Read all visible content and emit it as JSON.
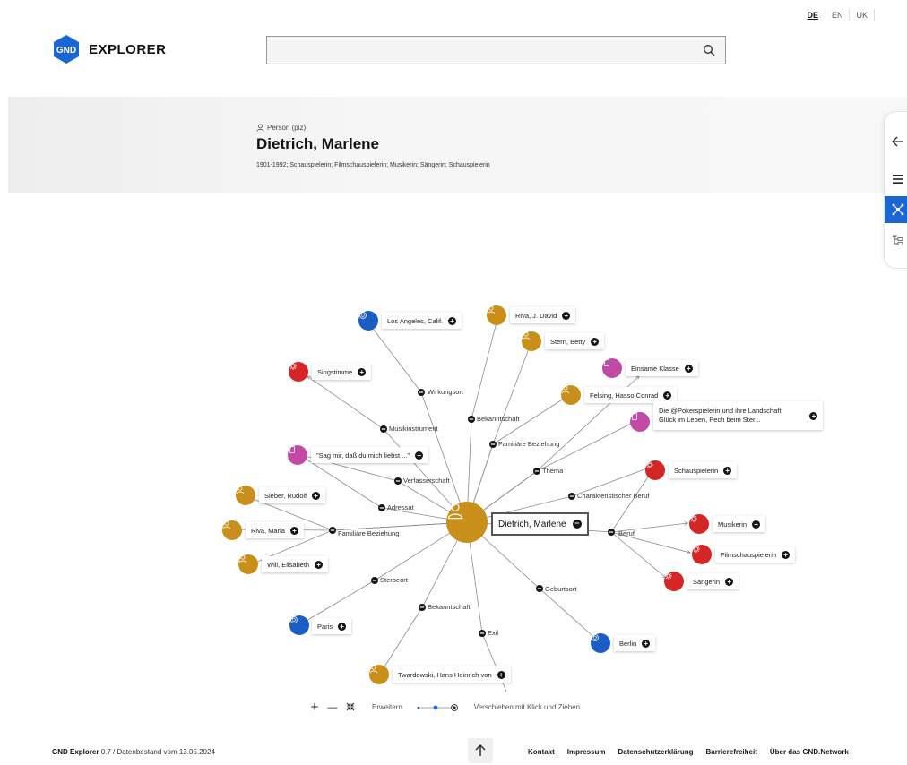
{
  "lang": {
    "items": [
      "DE",
      "EN",
      "UK"
    ],
    "active": "DE"
  },
  "header": {
    "logo_mark": "GND",
    "logo_text": "EXPLORER",
    "search_value": "",
    "search_placeholder": ""
  },
  "person": {
    "type": "Person (piz)",
    "name": "Dietrich, Marlene",
    "description": "1901-1992; Schauspielerin; Filmschauspielerin; Musikerin; Sängerin; Schauspielerin"
  },
  "side_tools": [
    "arrow-left-icon",
    "list-icon",
    "network-icon",
    "hierarchy-icon"
  ],
  "colors": {
    "accent": "#1a66d4",
    "person": "#c8901b",
    "place": "#1c5dc4",
    "subject": "#d42626",
    "work": "#c24aa6"
  },
  "graph": {
    "center": "Dietrich, Marlene",
    "relations": {
      "wirkungsort": "Wirkungsort",
      "bekanntschaft1": "Bekanntschaft",
      "familiaer1": "Familiäre Beziehung",
      "musikinstrument": "Musikinstrument",
      "thema": "Thema",
      "verfasserschaft": "Verfasserschaft",
      "charakteristisch": "Charakteristischer Beruf",
      "adressat": "Adressat",
      "familiaer2": "Familiäre Beziehung",
      "beruf": "Beruf",
      "sterbeort": "Sterbeort",
      "geburtsort": "Geburtsort",
      "bekanntschaft2": "Bekanntschaft",
      "exil": "Exil"
    },
    "nodes": {
      "losangeles": "Los Angeles, Calif.",
      "rivadavid": "Riva, J. David",
      "sternbetty": "Stern, Betty",
      "singstimme": "Singstimme",
      "einsame": "Einsame Klasse",
      "felsing": "Felsing, Hasso Conrad",
      "poker1": "Die @Pokerspielerin und ihre Landschaft",
      "poker2": "Glück im Leben, Pech beim Ster...",
      "sagmir": "\"Sag mir, daß du mich liebst ...\"",
      "schauspielerin": "Schauspielerin",
      "sieber": "Sieber, Rudolf",
      "rivamaria": "Riva, Maria",
      "musikerin": "Musikerin",
      "filmschau": "Filmschauspielerin",
      "will": "Will, Elisabeth",
      "saengerin": "Sängerin",
      "paris": "Paris",
      "berlin": "Berlin",
      "twardowski": "Twardowski, Hans Heinrich von"
    }
  },
  "legend": {
    "zoom_in": "+",
    "zoom_out": "—",
    "expand_label": "Erweitern",
    "move_label": "Verschieben mit Klick und Ziehen"
  },
  "footer": {
    "app_name": "GND Explorer",
    "version_text": " 0.7 / Datenbestand vom 13.05.2024",
    "links": [
      "Kontakt",
      "Impressum",
      "Datenschutzerklärung",
      "Barrierefreiheit",
      "Über das GND.Network"
    ]
  }
}
